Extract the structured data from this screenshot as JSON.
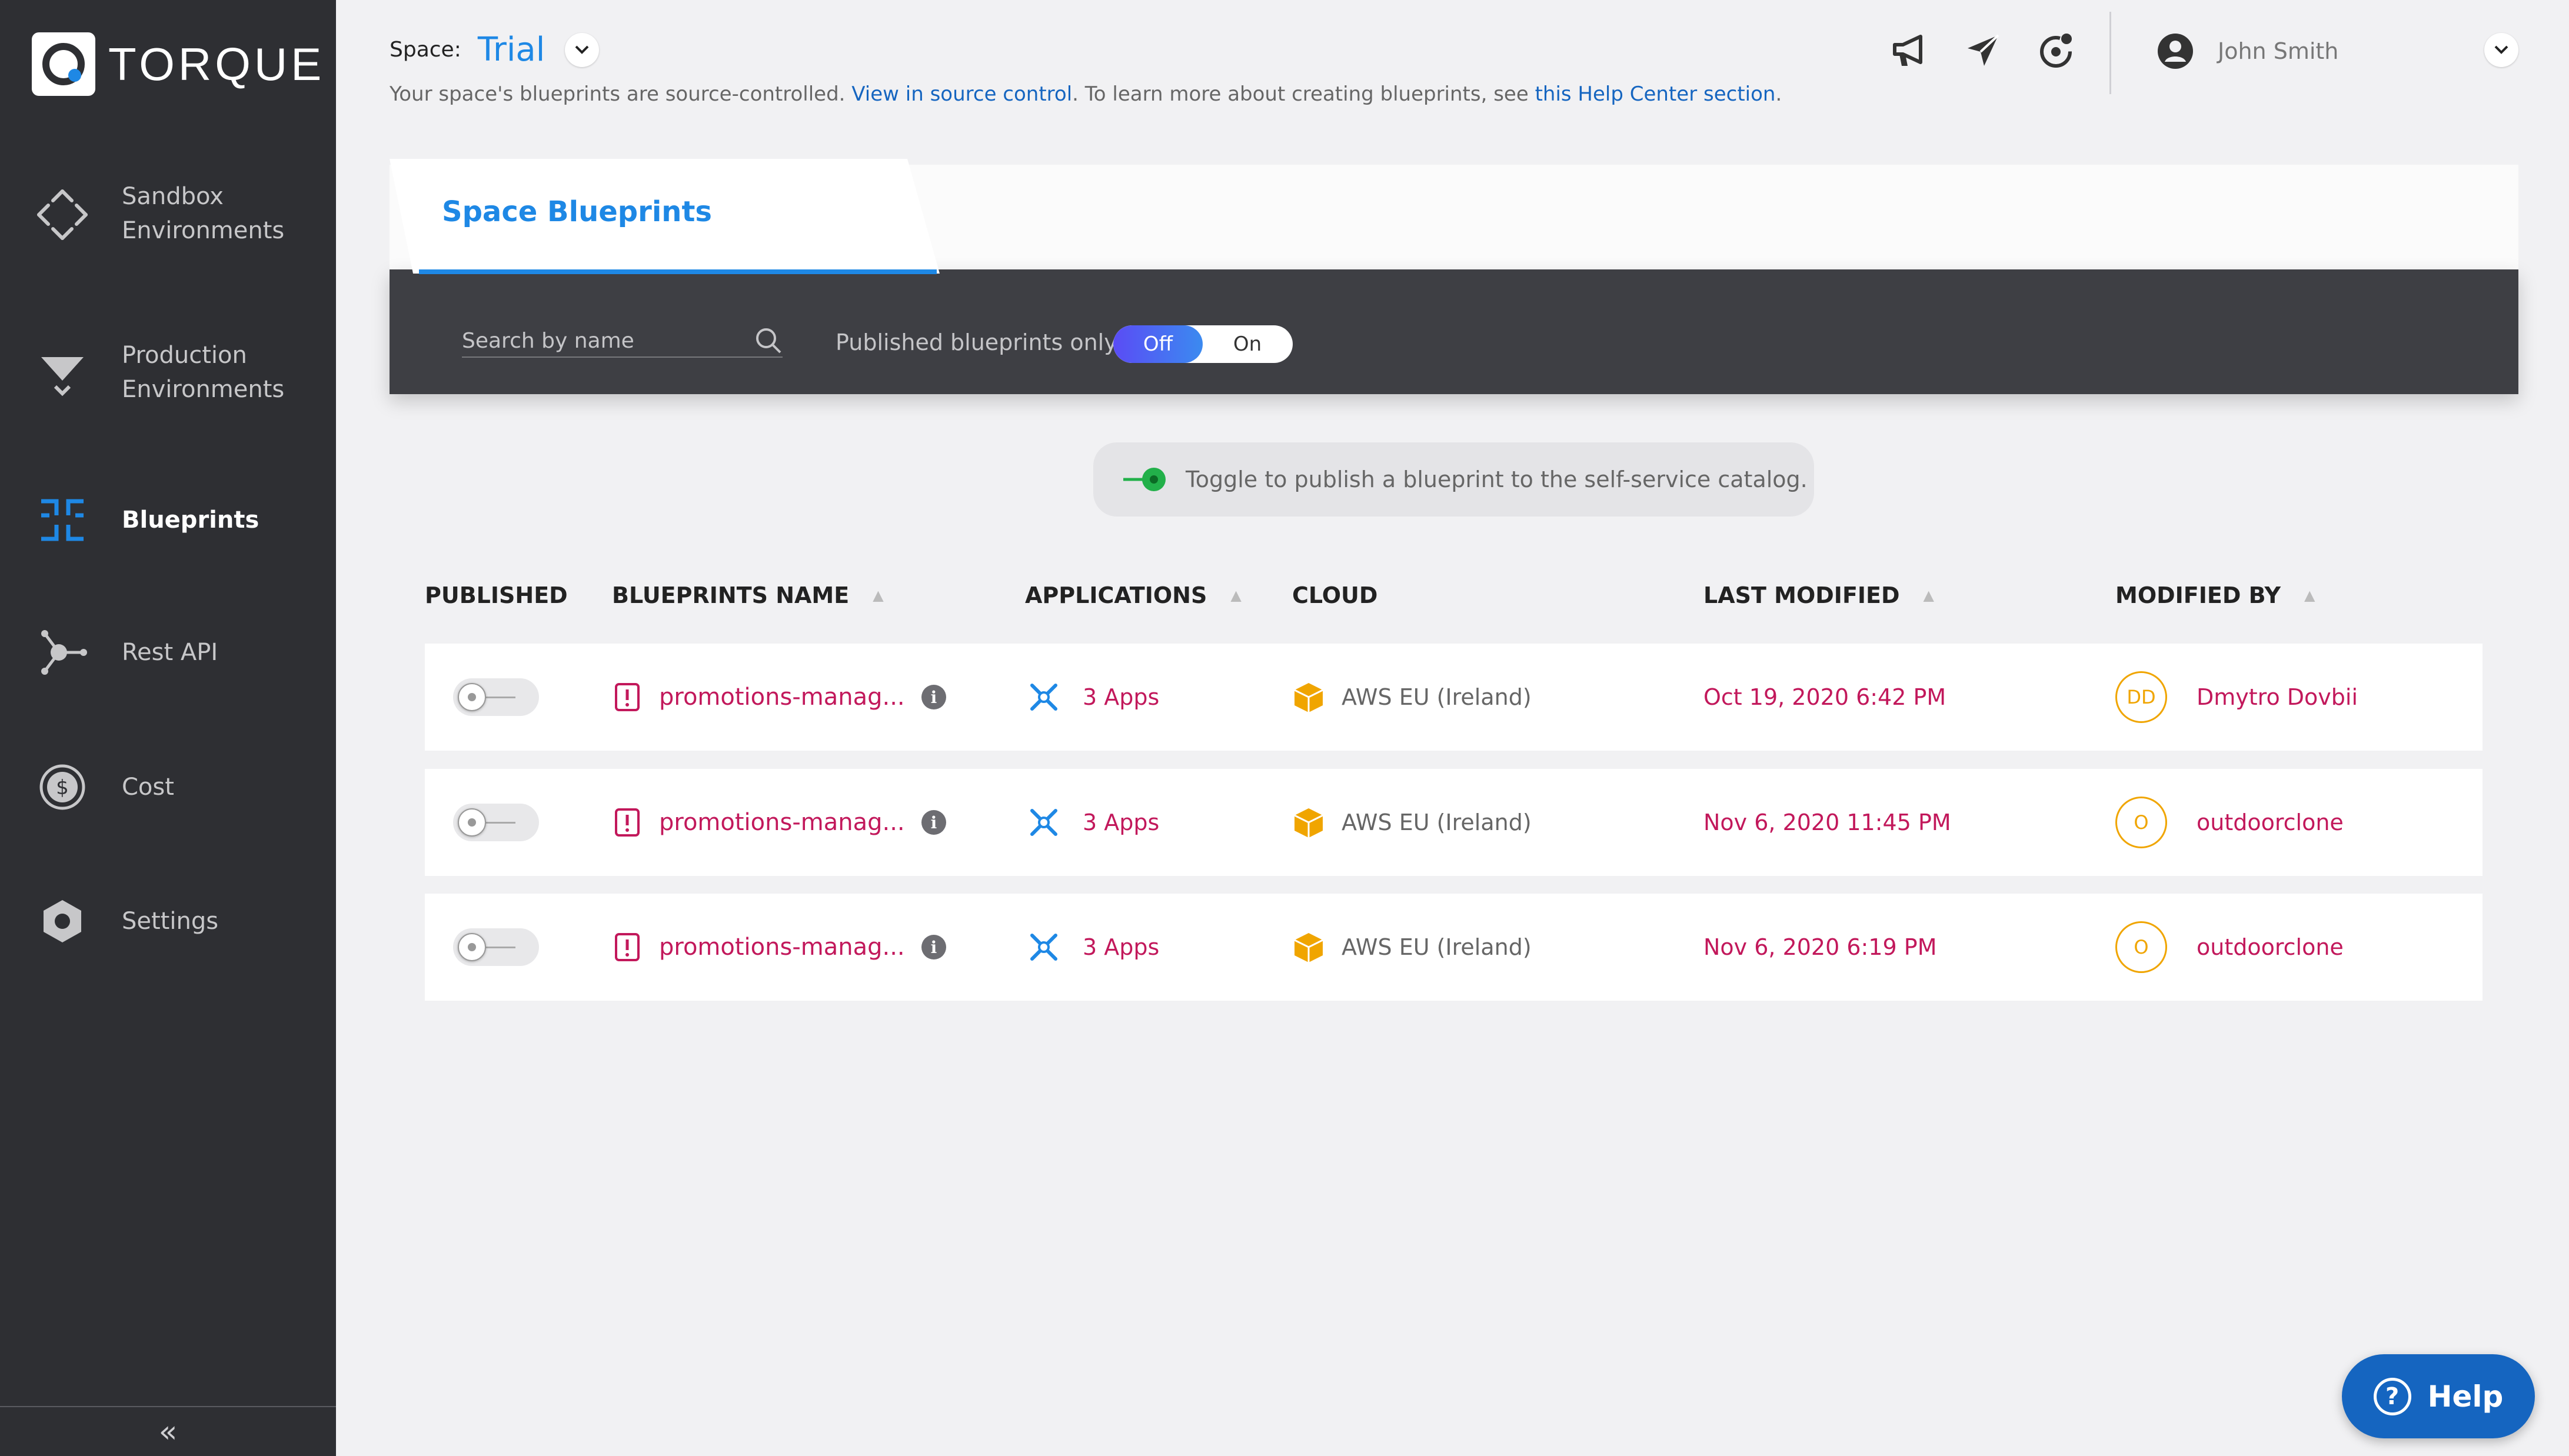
{
  "brand": {
    "name": "TORQUE"
  },
  "sidebar": {
    "items": [
      {
        "label_line1": "Sandbox",
        "label_line2": "Environments",
        "icon": "sandbox-icon"
      },
      {
        "label_line1": "Production",
        "label_line2": "Environments",
        "icon": "production-icon"
      },
      {
        "label_line1": "Blueprints",
        "label_line2": "",
        "icon": "blueprints-icon"
      },
      {
        "label_line1": "Rest API",
        "label_line2": "",
        "icon": "rest-api-icon"
      },
      {
        "label_line1": "Cost",
        "label_line2": "",
        "icon": "cost-icon"
      },
      {
        "label_line1": "Settings",
        "label_line2": "",
        "icon": "settings-icon"
      }
    ],
    "collapse": "«"
  },
  "header": {
    "space_label": "Space:",
    "space_name": "Trial",
    "sub_prefix": "Your space's blueprints are source-controlled. ",
    "sub_link1": "View in source control",
    "sub_mid": ". To learn more about creating blueprints, see ",
    "sub_link2": "this Help Center section",
    "sub_suffix": ".",
    "user_name": "John Smith"
  },
  "panel": {
    "tab_title": "Space Blueprints",
    "search_placeholder": "Search by name",
    "published_only_label": "Published blueprints only",
    "seg_off": "Off",
    "seg_on": "On"
  },
  "hint": {
    "text": "Toggle to publish a blueprint to the self-service catalog."
  },
  "table": {
    "headers": {
      "published": "PUBLISHED",
      "name": "BLUEPRINTS NAME",
      "applications": "APPLICATIONS",
      "cloud": "CLOUD",
      "last_modified": "LAST MODIFIED",
      "modified_by": "MODIFIED BY"
    },
    "rows": [
      {
        "name": "promotions-manag...",
        "apps": "3 Apps",
        "cloud": "AWS EU (Ireland)",
        "modified": "Oct 19, 2020 6:42 PM",
        "initials": "DD",
        "by": "Dmytro Dovbii"
      },
      {
        "name": "promotions-manag...",
        "apps": "3 Apps",
        "cloud": "AWS EU (Ireland)",
        "modified": "Nov 6, 2020 11:45 PM",
        "initials": "O",
        "by": "outdoorclone"
      },
      {
        "name": "promotions-manag...",
        "apps": "3 Apps",
        "cloud": "AWS EU (Ireland)",
        "modified": "Nov 6, 2020 6:19 PM",
        "initials": "O",
        "by": "outdoorclone"
      }
    ]
  },
  "help": {
    "label": "Help"
  },
  "colors": {
    "accent": "#1e88e5",
    "sidebar": "#2e2f33",
    "link_red": "#c2185b",
    "avatar": "#f0a500"
  }
}
